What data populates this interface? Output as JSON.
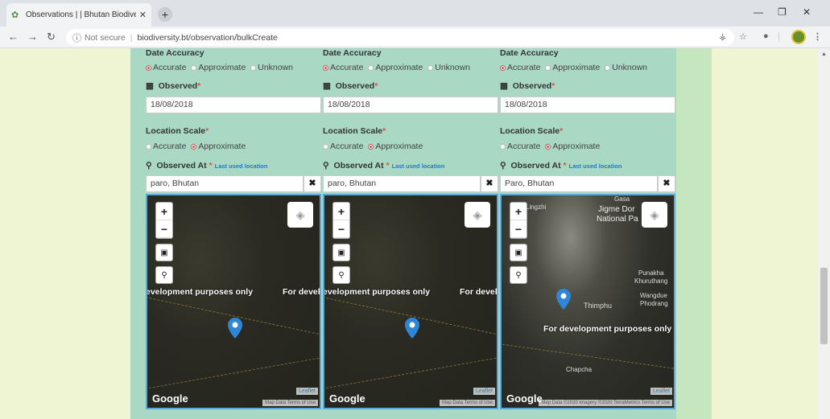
{
  "browser": {
    "tab_title": "Observations | | Bhutan Biodivers",
    "url_not_secure": "Not secure",
    "url": "biodiversity.bt/observation/bulkCreate"
  },
  "form": {
    "date_accuracy_label": "Date Accuracy",
    "accuracy_options": [
      "Accurate",
      "Approximate",
      "Unknown"
    ],
    "observed_label": "Observed",
    "location_scale_label": "Location Scale",
    "scale_options": [
      "Accurate",
      "Approximate"
    ],
    "observed_at_label": "Observed At",
    "last_used_location": "Last used location",
    "dev_text": "For development purposes only",
    "google": "Google",
    "leaflet": "Leaflet",
    "columns": [
      {
        "date": "18/08/2018",
        "location": "paro, Bhutan",
        "dev_left": "evelopment purposes only",
        "dev_right": "For develo",
        "attribution": "Map Data  Terms of Use"
      },
      {
        "date": "18/08/2018",
        "location": "paro, Bhutan",
        "dev_left": "evelopment purposes only",
        "dev_right": "For develo",
        "attribution": "Map Data  Terms of Use"
      },
      {
        "date": "18/08/2018",
        "location": "Paro, Bhutan",
        "dev_center": "For development purposes only",
        "attribution": "Map Data ©2020 Imagery ©2020 TerraMetrics  Terms of Use",
        "places": [
          "Gasa",
          "Jigme Dor",
          "National Pa",
          "Lingzhi",
          "Punakha",
          "Khuruthang",
          "Wangdue",
          "Phodrang",
          "Thimphu",
          "Chapcha"
        ]
      }
    ]
  }
}
